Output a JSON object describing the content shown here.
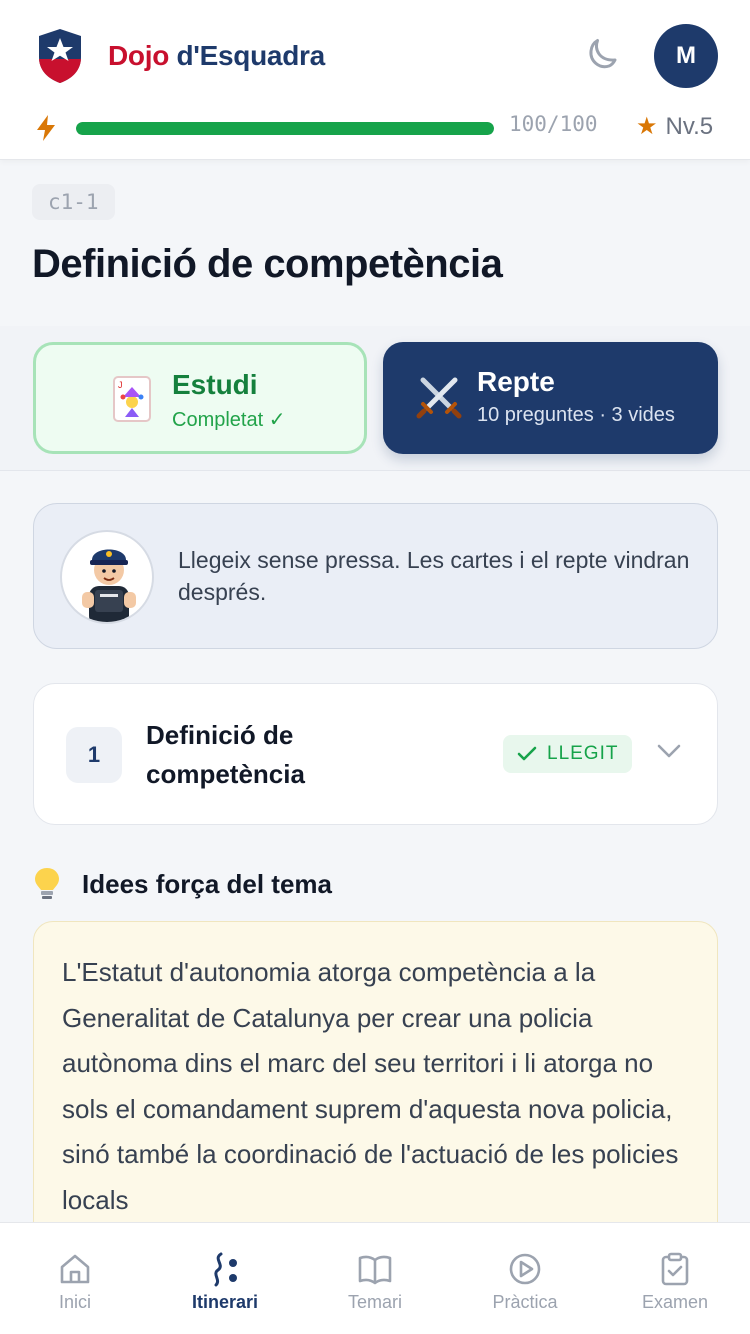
{
  "header": {
    "brand_part1": "Dojo",
    "brand_part2": "d'Esquadra",
    "avatar_initial": "M",
    "xp_text": "100/100",
    "xp_progress": 1.0,
    "level_text": "Nv.5",
    "icons": [
      "shield-logo",
      "moon-icon",
      "bolt-icon",
      "star-icon"
    ]
  },
  "lesson": {
    "code": "c1-1",
    "title": "Definició de competència"
  },
  "modes": {
    "estudi": {
      "title": "Estudi",
      "status": "Completat ✓",
      "icon": "jester-card-icon"
    },
    "repte": {
      "title": "Repte",
      "details": "10 preguntes · 3 vides",
      "icon": "crossed-swords-icon"
    }
  },
  "callout": {
    "text": "Llegeix sense pressa. Les cartes i el repte vindran després."
  },
  "section": {
    "number": "1",
    "title": "Definició de competència",
    "badge": "LLEGIT"
  },
  "idees": {
    "title": "Idees força del tema",
    "text": "L'Estatut d'autonomia atorga competència a la Generalitat de Catalunya per crear una policia autònoma dins el marc del seu territori i li atorga no sols el comandament suprem d'aquesta nova policia, sinó també la coordinació de l'actuació de les policies locals"
  },
  "nav": {
    "items": [
      {
        "label": "Inici",
        "icon": "home-icon"
      },
      {
        "label": "Itinerari",
        "icon": "route-icon"
      },
      {
        "label": "Temari",
        "icon": "book-icon"
      },
      {
        "label": "Pràctica",
        "icon": "play-icon"
      },
      {
        "label": "Examen",
        "icon": "clipboard-check-icon"
      }
    ],
    "active": "Itinerari"
  },
  "colors": {
    "navy": "#1e3a6b",
    "brand_red": "#c8102e",
    "success": "#16a34a",
    "amber": "#d97706"
  }
}
